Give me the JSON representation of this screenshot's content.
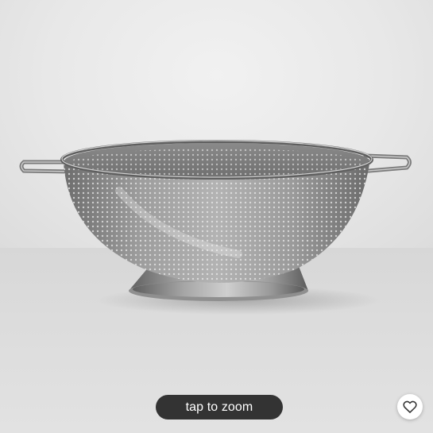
{
  "product_image": {
    "icon": "colander-image"
  },
  "zoom_hint": {
    "label": "tap to zoom"
  },
  "favorite": {
    "icon": "heart-outline-icon"
  },
  "colors": {
    "pill_background": "#333333",
    "pill_text": "#ffffff",
    "favorite_background": "#ffffff"
  }
}
